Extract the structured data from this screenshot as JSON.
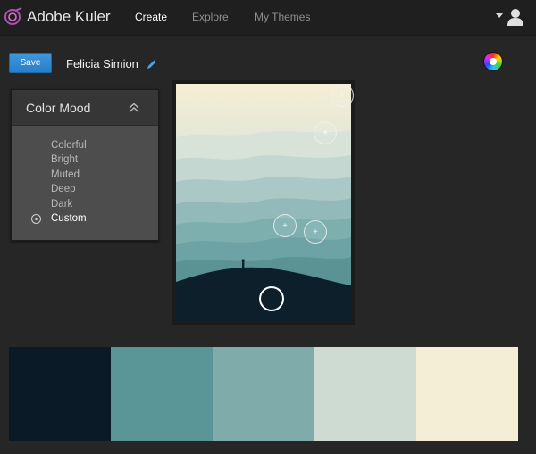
{
  "header": {
    "app_title": "Adobe Kuler",
    "nav": [
      {
        "label": "Create",
        "active": true
      },
      {
        "label": "Explore",
        "active": false
      },
      {
        "label": "My Themes",
        "active": false
      }
    ],
    "icons": {
      "logo": "kuler-logo",
      "user": "user-icon",
      "menu": "caret-down-icon"
    }
  },
  "toolbar": {
    "save_label": "Save",
    "theme_name": "Felicia Simion",
    "edit_icon": "pencil-icon",
    "color_wheel_icon": "color-wheel-icon"
  },
  "color_mood": {
    "title": "Color Mood",
    "options": [
      "Colorful",
      "Bright",
      "Muted",
      "Deep",
      "Dark",
      "Custom"
    ],
    "selected": "Custom"
  },
  "image": {
    "subject": "misty mountain landscape",
    "pickers": 5
  },
  "swatches": [
    "#0b1a27",
    "#5a9598",
    "#7fabaa",
    "#cddbd2",
    "#f5eed7"
  ]
}
